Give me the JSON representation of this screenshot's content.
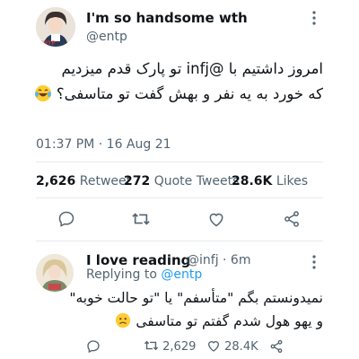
{
  "tweet": {
    "name": "I'm so handsome wth",
    "handle": "@entp",
    "avatar_caption": "ENTP",
    "text_line1": "امروز داشتیم با @infj تو پارک قدم میزدیم",
    "text_line2": "که خورد به یه نفر و بهش گفت تو متاسفی؟",
    "timestamp": "01:37 PM · 16 Aug 21",
    "retweets_count": "2,626",
    "retweets_label": "Retweet",
    "quotes_count": "272",
    "quotes_label": "Quote Tweets",
    "likes_count": "28.6K",
    "likes_label": "Likes"
  },
  "reply": {
    "name": "I love reading",
    "handle_time": "@infj · 6m",
    "replying_prefix": "Replying to",
    "replying_to": "@entp",
    "text_line1": "نمیدونستم بگم \"متأسفم\" یا \"تو حالت خوبه\"",
    "text_line2": "و یهو هول شدم گفتم تو متاسفی",
    "retweet_count": "2,629",
    "like_count": "28.4K"
  },
  "colors": {
    "accent": "#1d9bf0",
    "muted": "#536471",
    "text": "#0f1419"
  },
  "icons": [
    "reply-icon",
    "retweet-icon",
    "like-icon",
    "share-icon",
    "more-icon",
    "laughing-emoji",
    "worried-emoji"
  ]
}
